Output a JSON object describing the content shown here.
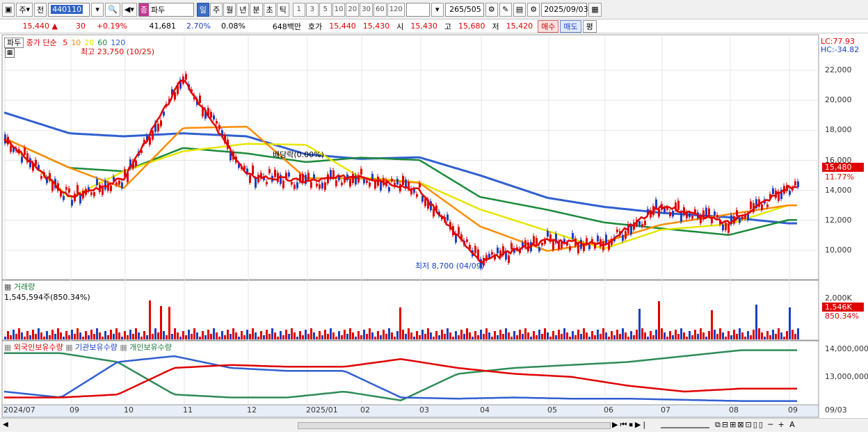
{
  "toolbar": {
    "type_label": "주",
    "prefix_label": "전",
    "code": "440110",
    "tag_label": "종",
    "name": "파두",
    "periods": [
      "일",
      "주",
      "월",
      "년",
      "분",
      "초",
      "틱"
    ],
    "active_period": "일",
    "intervals": [
      "1",
      "3",
      "5",
      "10",
      "20",
      "30",
      "60",
      "120"
    ],
    "count": "265",
    "count_total": "/505",
    "date": "2025/09/03"
  },
  "info": {
    "price": "15,440",
    "change_arrow": "▲",
    "change": "30",
    "change_pct": "+0.19%",
    "volume": "41,681",
    "turnover_pct": "2.70%",
    "misc_pct": "0.08%",
    "amount": "648백만",
    "ask_label": "호가",
    "ask1": "15,440",
    "ask2": "15,430",
    "open_label": "시",
    "open": "15,430",
    "high_label": "고",
    "high": "15,680",
    "low_label": "저",
    "low": "15,420",
    "buy_label": "매수",
    "sell_label": "매도",
    "avg_label": "평"
  },
  "price_panel": {
    "tab_label": "파두",
    "legend_prefix": "종가 단순",
    "ma_periods": [
      "5",
      "10",
      "20",
      "60",
      "120"
    ],
    "ma_colors": [
      "#e00000",
      "#ff8c00",
      "#e6e600",
      "#1a8a3a",
      "#2f5fd0"
    ],
    "high_annotation": "최고 23,750 (10/25)",
    "low_annotation": "최저 8,700 (04/09)",
    "dividend_annotation": "배당락(0.00%)",
    "lc_label": "LC:77.93",
    "hc_label": "HC:-34.82",
    "current_label": "15,480",
    "current_pct": "11.77%",
    "yticks": [
      "22,000",
      "20,000",
      "18,000",
      "16,000",
      "14,000",
      "12,000",
      "10,000"
    ]
  },
  "volume_panel": {
    "title": "거래량",
    "value": "1,545,594주(850.34%)",
    "ytick": "2,000K",
    "current_label": "1,546K",
    "current_pct": "850.34%"
  },
  "holding_panel": {
    "legend": [
      "외국인보유수량",
      "기관보유수량",
      "개인보유수량"
    ],
    "yticks": [
      "14,000,000",
      "13,000,000"
    ]
  },
  "x_axis": [
    "2024/07",
    "09",
    "10",
    "11",
    "12",
    "2025/01",
    "02",
    "03",
    "04",
    "05",
    "06",
    "07",
    "08",
    "09",
    "09/03"
  ],
  "chart_data": {
    "type": "line",
    "title": "",
    "ylim": [
      8000,
      24000
    ],
    "x": [
      "2024/07",
      "09",
      "10",
      "11",
      "12",
      "2025/01",
      "02",
      "03",
      "04",
      "05",
      "06",
      "07",
      "08",
      "09"
    ],
    "series": [
      {
        "name": "5",
        "values": [
          17500,
          13500,
          14800,
          21500,
          15000,
          14600,
          15000,
          14000,
          9200,
          10700,
          10400,
          13000,
          11800,
          14200
        ]
      },
      {
        "name": "120",
        "values": [
          19200,
          17800,
          17600,
          17800,
          17600,
          16400,
          16100,
          16200,
          15000,
          13500,
          12900,
          12500,
          12200,
          11800
        ]
      }
    ],
    "annotations": [
      "최고 23,750 (10/25)",
      "최저 8,700 (04/09)",
      "배당락(0.00%)"
    ]
  }
}
